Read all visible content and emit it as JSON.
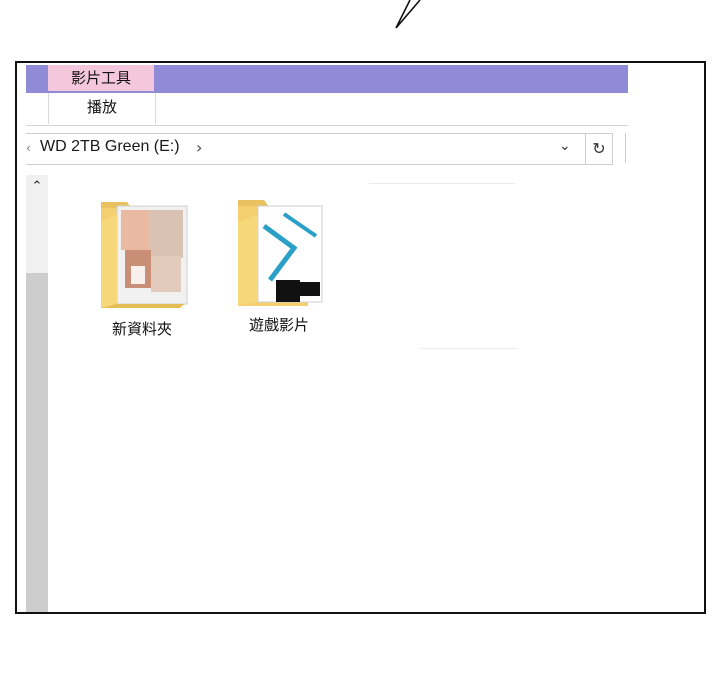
{
  "ribbon": {
    "context_tab": "影片工具",
    "play_tab": "播放"
  },
  "address": {
    "path": "WD 2TB Green (E:)",
    "separator": "›",
    "dropdown_glyph": "⌄",
    "refresh_glyph": "↻",
    "left_marker": "‹"
  },
  "scrollbar": {
    "up_glyph": "⌃"
  },
  "files": [
    {
      "name": "新資料夾",
      "icon": "folder-with-photos-icon"
    },
    {
      "name": "遊戲影片",
      "icon": "folder-with-media-icon"
    }
  ],
  "colors": {
    "ribbon_accent": "#8f8bd6",
    "context_tab": "#f5c7dc",
    "folder": "#f7d77c"
  }
}
